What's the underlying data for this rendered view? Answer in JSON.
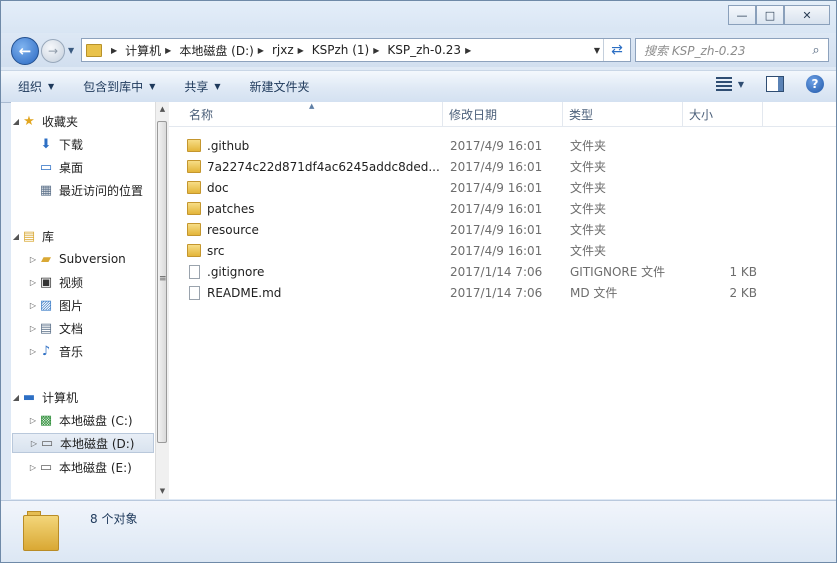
{
  "caption": {
    "minimize_label": "—",
    "maximize_label": "□",
    "close_label": "✕"
  },
  "nav": {
    "back_label": "←",
    "forward_label": "→",
    "breadcrumbs": [
      "计算机",
      "本地磁盘 (D:)",
      "rjxz",
      "KSPzh (1)",
      "KSP_zh-0.23"
    ],
    "search_placeholder": "搜索 KSP_zh-0.23"
  },
  "toolbar": {
    "organize": "组织",
    "include_library": "包含到库中",
    "share": "共享",
    "new_folder": "新建文件夹"
  },
  "sidebar": {
    "favorites": {
      "label": "收藏夹",
      "items": [
        "下载",
        "桌面",
        "最近访问的位置"
      ]
    },
    "libraries": {
      "label": "库",
      "items": [
        "Subversion",
        "视频",
        "图片",
        "文档",
        "音乐"
      ]
    },
    "computer": {
      "label": "计算机",
      "items": [
        "本地磁盘 (C:)",
        "本地磁盘 (D:)",
        "本地磁盘 (E:)"
      ]
    }
  },
  "columns": {
    "name": "名称",
    "date": "修改日期",
    "type": "类型",
    "size": "大小"
  },
  "files": [
    {
      "name": ".github",
      "date": "2017/4/9 16:01",
      "type": "文件夹",
      "size": "",
      "kind": "folder"
    },
    {
      "name": "7a2274c22d871df4ac6245addc8ded...",
      "date": "2017/4/9 16:01",
      "type": "文件夹",
      "size": "",
      "kind": "folder"
    },
    {
      "name": "doc",
      "date": "2017/4/9 16:01",
      "type": "文件夹",
      "size": "",
      "kind": "folder"
    },
    {
      "name": "patches",
      "date": "2017/4/9 16:01",
      "type": "文件夹",
      "size": "",
      "kind": "folder"
    },
    {
      "name": "resource",
      "date": "2017/4/9 16:01",
      "type": "文件夹",
      "size": "",
      "kind": "folder"
    },
    {
      "name": "src",
      "date": "2017/4/9 16:01",
      "type": "文件夹",
      "size": "",
      "kind": "folder"
    },
    {
      "name": ".gitignore",
      "date": "2017/1/14 7:06",
      "type": "GITIGNORE 文件",
      "size": "1 KB",
      "kind": "file"
    },
    {
      "name": "README.md",
      "date": "2017/1/14 7:06",
      "type": "MD 文件",
      "size": "2 KB",
      "kind": "file"
    }
  ],
  "status": {
    "count_text": "8 个对象"
  },
  "colors": {
    "accent": "#2a68c2",
    "folder": "#e3b53a",
    "toolbar_text": "#1e395b"
  }
}
